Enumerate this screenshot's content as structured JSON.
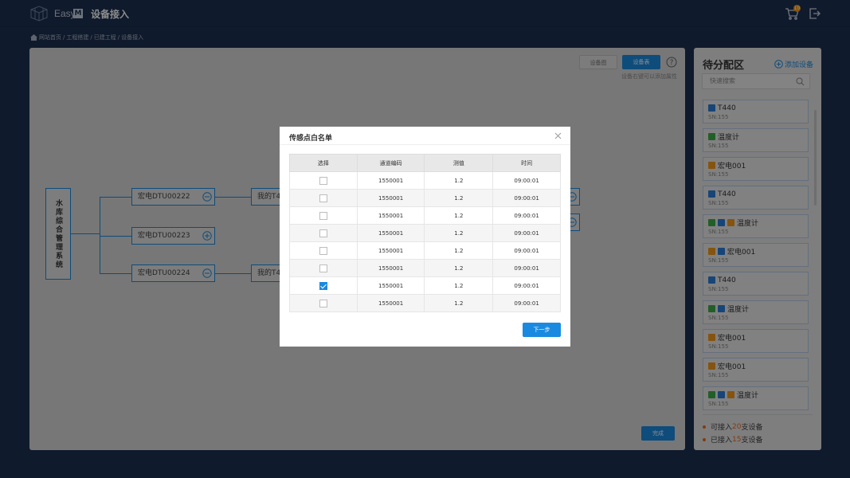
{
  "topbar": {
    "brand": "Easy",
    "brand_mark": "M",
    "title": "设备接入",
    "cart_badge": "10"
  },
  "breadcrumb": [
    "网站首页",
    "工程搭建",
    "已建工程",
    "设备接入"
  ],
  "main": {
    "tab_graph": "设备图",
    "tab_table": "设备表",
    "hint": "设备右键可以添加属性",
    "done": "完成",
    "root": "水库综合管理系统",
    "nodes": [
      {
        "label": "宏电DTU00222"
      },
      {
        "label": "宏电DTU00223"
      },
      {
        "label": "宏电DTU00224"
      },
      {
        "label": "我的T44"
      },
      {
        "label": "我的T44"
      }
    ]
  },
  "side": {
    "title": "待分配区",
    "add": "添加设备",
    "search_placeholder": "快速搜索",
    "devices": [
      {
        "name": "T440",
        "sn": "SN:155",
        "tags": [
          "blue"
        ]
      },
      {
        "name": "温度计",
        "sn": "SN:155",
        "tags": [
          "green"
        ]
      },
      {
        "name": "宏电001",
        "sn": "SN:155",
        "tags": [
          "orange"
        ]
      },
      {
        "name": "T440",
        "sn": "SN:155",
        "tags": [
          "blue"
        ]
      },
      {
        "name": "温度计",
        "sn": "SN:155",
        "tags": [
          "green",
          "blue",
          "orange"
        ]
      },
      {
        "name": "宏电001",
        "sn": "SN:155",
        "tags": [
          "orange",
          "blue"
        ]
      },
      {
        "name": "T440",
        "sn": "SN:155",
        "tags": [
          "blue"
        ]
      },
      {
        "name": "温度计",
        "sn": "SN:155",
        "tags": [
          "green",
          "blue"
        ]
      },
      {
        "name": "宏电001",
        "sn": "SN:155",
        "tags": [
          "orange"
        ]
      },
      {
        "name": "宏电001",
        "sn": "SN:155",
        "tags": [
          "orange"
        ]
      },
      {
        "name": "温度计",
        "sn": "SN:155",
        "tags": [
          "green",
          "blue",
          "orange"
        ]
      }
    ],
    "stat1": {
      "prefix": "可接入",
      "num": "20",
      "suffix": "支设备"
    },
    "stat2": {
      "prefix": "已接入",
      "num": "15",
      "suffix": "支设备"
    }
  },
  "modal": {
    "title": "传感点白名单",
    "columns": [
      "选择",
      "通道编码",
      "测值",
      "时间"
    ],
    "rows": [
      {
        "checked": false,
        "code": "1550001",
        "value": "1.2",
        "time": "09:00:01"
      },
      {
        "checked": false,
        "code": "1550001",
        "value": "1.2",
        "time": "09:00:01"
      },
      {
        "checked": false,
        "code": "1550001",
        "value": "1.2",
        "time": "09:00:01"
      },
      {
        "checked": false,
        "code": "1550001",
        "value": "1.2",
        "time": "09:00:01"
      },
      {
        "checked": false,
        "code": "1550001",
        "value": "1.2",
        "time": "09:00:01"
      },
      {
        "checked": false,
        "code": "1550001",
        "value": "1.2",
        "time": "09:00:01"
      },
      {
        "checked": true,
        "code": "1550001",
        "value": "1.2",
        "time": "09:00:01"
      },
      {
        "checked": false,
        "code": "1550001",
        "value": "1.2",
        "time": "09:00:01"
      }
    ],
    "next": "下一步"
  },
  "colors": {
    "accent": "#1a8ae0",
    "header_bg": "#1d3150",
    "highlight": "#ef6a1e"
  }
}
